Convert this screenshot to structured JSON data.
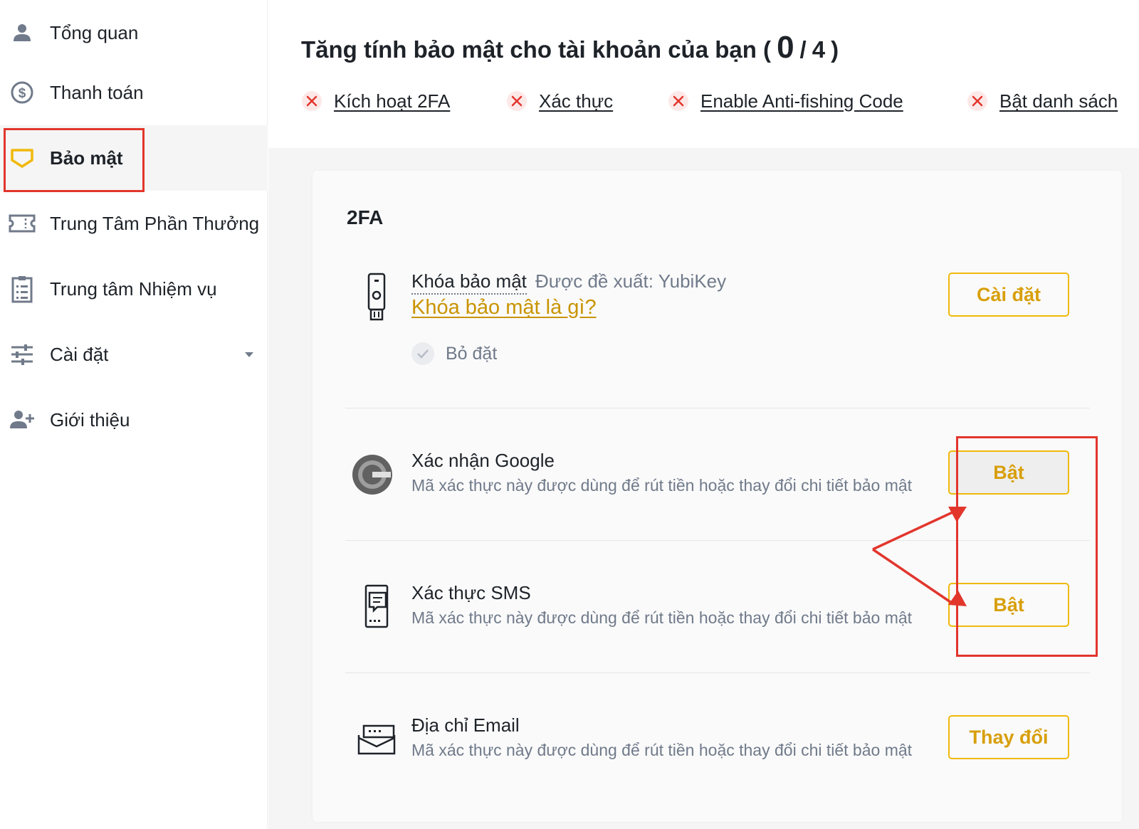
{
  "sidebar": {
    "items": [
      {
        "label": "Tổng quan",
        "icon": "user-icon"
      },
      {
        "label": "Thanh toán",
        "icon": "dollar-circle-icon"
      },
      {
        "label": "Bảo mật",
        "icon": "shield-icon",
        "active": true
      },
      {
        "label": "Trung Tâm Phần Thưởng",
        "icon": "ticket-icon"
      },
      {
        "label": "Trung tâm Nhiệm vụ",
        "icon": "checklist-icon"
      },
      {
        "label": "Cài đặt",
        "icon": "sliders-icon",
        "has_dropdown": true
      },
      {
        "label": "Giới thiệu",
        "icon": "add-user-icon"
      }
    ]
  },
  "header": {
    "title_prefix": "Tăng tính bảo mật cho tài khoản của bạn (",
    "completed": "0",
    "separator": "/",
    "total": "4",
    "title_suffix": ")",
    "steps": [
      {
        "label": "Kích hoạt 2FA",
        "status": "incomplete"
      },
      {
        "label": "Xác thực",
        "status": "incomplete"
      },
      {
        "label": "Enable Anti-fishing Code",
        "status": "incomplete"
      },
      {
        "label": "Bật danh sách",
        "status": "incomplete"
      }
    ]
  },
  "card": {
    "title": "2FA",
    "rows": [
      {
        "icon": "security-key-icon",
        "title": "Khóa bảo mật",
        "suggestion": "Được đề xuất: YubiKey",
        "link": "Khóa bảo mật là gì?",
        "status": "Bỏ đặt",
        "button": "Cài đặt"
      },
      {
        "icon": "google-authenticator-icon",
        "title": "Xác nhận Google",
        "description": "Mã xác thực này được dùng để rút tiền hoặc thay đổi chi tiết bảo mật",
        "button": "Bật"
      },
      {
        "icon": "sms-phone-icon",
        "title": "Xác thực SMS",
        "description": "Mã xác thực này được dùng để rút tiền hoặc thay đổi chi tiết bảo mật",
        "button": "Bật"
      },
      {
        "icon": "email-icon",
        "title": "Địa chỉ Email",
        "description": "Mã xác thực này được dùng để rút tiền hoặc thay đổi chi tiết bảo mật",
        "button": "Thay đổi"
      }
    ]
  },
  "colors": {
    "accent": "#f0b90b",
    "accent_text": "#d89f0b",
    "link": "#c99400",
    "annotation": "#e2362d",
    "error": "#e2362d",
    "text_primary": "#1e2329",
    "text_secondary": "#707a8a"
  }
}
